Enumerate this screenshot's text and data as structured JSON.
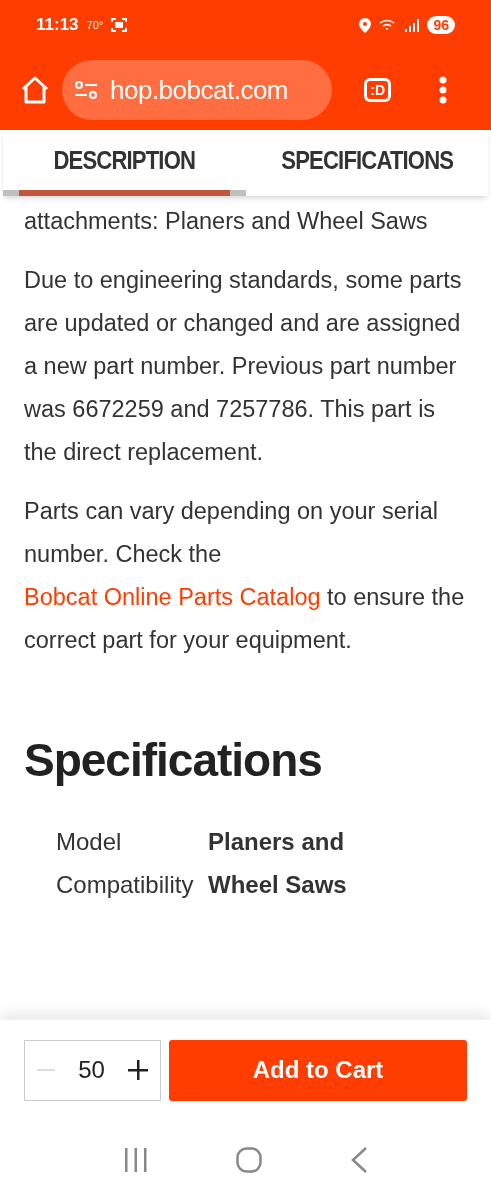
{
  "status_bar": {
    "time": "11:13",
    "temperature": "70°",
    "battery": "96"
  },
  "browser": {
    "url": "hop.bobcat.com",
    "extension_label": ":D"
  },
  "tabs": [
    {
      "label": "DESCRIPTION",
      "selected": true
    },
    {
      "label": "SPECIFICATIONS",
      "selected": false
    }
  ],
  "description": {
    "paragraphs": [
      {
        "kind": "text",
        "text": "attachments: Planers and Wheel Saws"
      },
      {
        "kind": "text",
        "text": "Due to engineering standards, some parts are updated or changed and are assigned a new part number. Previous part number was 6672259 and 7257786. This part is the direct replacement."
      },
      {
        "kind": "linked",
        "before": "Parts can vary depending on your serial number. Check the ",
        "link": "Bobcat Online Parts Catalog",
        "after": " to ensure the correct part for your equipment."
      }
    ]
  },
  "specifications": {
    "heading": "Specifications",
    "rows": [
      {
        "label": "Model Compatibility",
        "value": "Planers and Wheel Saws"
      }
    ]
  },
  "cart": {
    "quantity": "50",
    "minus_disabled": true,
    "button": "Add to Cart"
  }
}
